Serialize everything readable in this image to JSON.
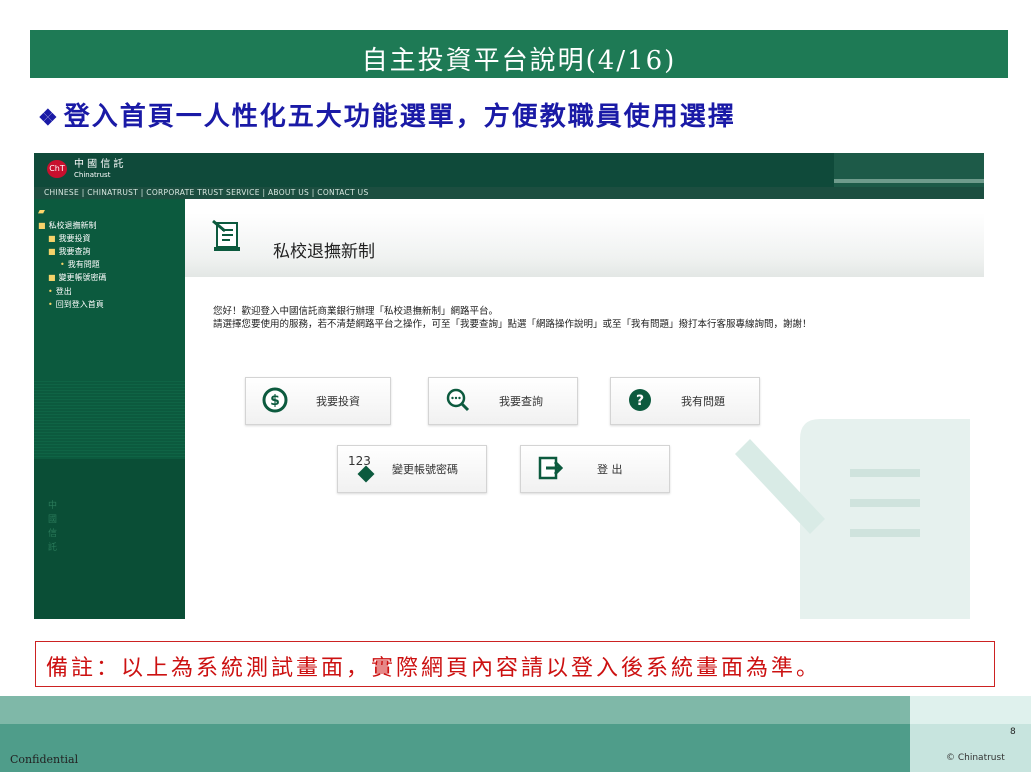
{
  "slide": {
    "title": "自主投資平台說明(4/16)",
    "subtitle_bullet": "❖",
    "subtitle": "登入首頁一人性化五大功能選單，方便教職員使用選擇",
    "note": "備註：以上為系統測試畫面，實際網頁內容請以登入後系統畫面為準。",
    "footer_left": "Confidential",
    "page_number": "8",
    "copyright": "© Chinatrust"
  },
  "site": {
    "logo_circle": "ChT",
    "logo_cn": "中 國 信 託",
    "logo_en": "Chinatrust",
    "nav": "CHINESE | CHINATRUST | CORPORATE TRUST SERVICE | ABOUT US | CONTACT US",
    "sidebar": {
      "root": "私校退撫新制",
      "items": [
        "我要投資",
        "我要查詢",
        "我有問題",
        "變更帳號密碼",
        "登出",
        "回到登入首頁"
      ],
      "vertical_text": "中國信託"
    },
    "main": {
      "heading": "私校退撫新制",
      "welcome_line1": "您好！歡迎登入中國信託商業銀行辦理「私校退撫新制」網路平台。",
      "welcome_line2": "請選擇您要使用的服務，若不清楚網路平台之操作，可至「我要查詢」點選「網路操作說明」或至「我有問題」撥打本行客服專線詢問，謝謝！",
      "buttons": {
        "invest": "我要投資",
        "query": "我要查詢",
        "question": "我有問題",
        "change_pw": "變更帳號密碼",
        "change_pw_icon_text": "123",
        "logout": "登 出"
      }
    }
  },
  "colors": {
    "title_bar": "#1e7a55",
    "subtitle": "#1a1aa6",
    "sidebar": "#0c5a3e",
    "note": "#cc1111",
    "footer": "#4f9d8a"
  }
}
